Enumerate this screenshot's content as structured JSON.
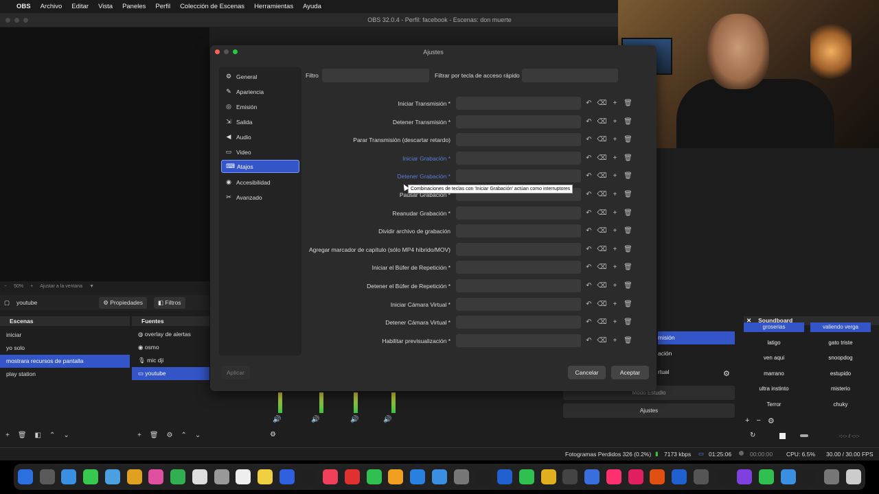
{
  "menubar": {
    "apple": "",
    "app_name": "OBS",
    "items": [
      "Archivo",
      "Editar",
      "Vista",
      "Paneles",
      "Perfil",
      "Colección de Escenas",
      "Herramientas",
      "Ayuda"
    ]
  },
  "obs_title": "OBS 32.0.4 - Perfil: facebook - Escenas: don muerte",
  "preview_bar": {
    "zoom": "50%",
    "fit": "Ajustar a la ventana"
  },
  "source_bar": {
    "source": "youtube",
    "properties": "Propiedades",
    "filters": "Filtros"
  },
  "scenes": {
    "title": "Escenas",
    "items": [
      "iniciar",
      "yo solo",
      "mostrara recursos de pantalla",
      "play station"
    ],
    "selected_index": 2
  },
  "sources": {
    "title": "Fuentes",
    "items": [
      "overlay de alertas",
      "osmo",
      "mic dji",
      "youtube"
    ],
    "selected_index": 3
  },
  "dialog": {
    "title": "Ajustes",
    "filter_label": "Filtro",
    "hotkey_filter_label": "Filtrar por tecla de acceso rápido",
    "nav": [
      "General",
      "Apariencia",
      "Emisión",
      "Salida",
      "Audio",
      "Video",
      "Atajos",
      "Accesibilidad",
      "Avanzado"
    ],
    "nav_icons": [
      "gear-icon",
      "brush-icon",
      "broadcast-icon",
      "output-icon",
      "speaker-icon",
      "monitor-icon",
      "keyboard-icon",
      "accessibility-icon",
      "tools-icon"
    ],
    "nav_selected": 6,
    "hotkeys": [
      {
        "label": "Iniciar Transmisión *",
        "highlight": false
      },
      {
        "label": "Detener Transmisión *",
        "highlight": false
      },
      {
        "label": "Parar Transmisión (descartar retardo)",
        "highlight": false
      },
      {
        "label": "Iniciar Grabación *",
        "highlight": true
      },
      {
        "label": "Detener Grabación *",
        "highlight": true
      },
      {
        "label": "Pausar Grabación *",
        "highlight": false
      },
      {
        "label": "Reanudar Grabación *",
        "highlight": false
      },
      {
        "label": "Dividir archivo de grabación",
        "highlight": false
      },
      {
        "label": "Agregar marcador de capítulo (sólo MP4 híbrido/MOV)",
        "highlight": false
      },
      {
        "label": "Iniciar el Búfer de Repetición *",
        "highlight": false
      },
      {
        "label": "Detener el Búfer de Repetición *",
        "highlight": false
      },
      {
        "label": "Iniciar Cámara Virtual *",
        "highlight": false
      },
      {
        "label": "Detener Cámara Virtual *",
        "highlight": false
      },
      {
        "label": "Habilitar previsualización *",
        "highlight": false
      }
    ],
    "tooltip": "Combinaciones de teclas con 'Iniciar Grabación' actúan como interruptores",
    "apply": "Aplicar",
    "cancel": "Cancelar",
    "accept": "Aceptar"
  },
  "soundboard": {
    "title": "Soundboard",
    "buttons": [
      "groserias",
      "valiendo verga",
      "latigo",
      "gato triste",
      "ven aqui",
      "snoopdog",
      "marrano",
      "estupido",
      "ultra instinto",
      "misterio",
      "Terror",
      "chuky"
    ]
  },
  "controls": {
    "partial_labels": [
      "misión",
      "ación",
      "rtual"
    ],
    "studio_mode": "Modo Estudio",
    "settings": "Ajustes"
  },
  "status": {
    "dropped_frames": "Fotogramas Perdidos 326 (0.2%)",
    "bitrate": "7173 kbps",
    "stream_time": "01:25:06",
    "rec_time": "00:00:00",
    "cpu": "CPU: 6.5%",
    "fps": "30.00 / 30.00 FPS",
    "extra": "-:-:- / -:-:-"
  },
  "colors": {
    "accent": "#3355c8",
    "dialog_bg": "#2b2b2b",
    "close": "#ff5f57",
    "zoom": "#28c840"
  }
}
